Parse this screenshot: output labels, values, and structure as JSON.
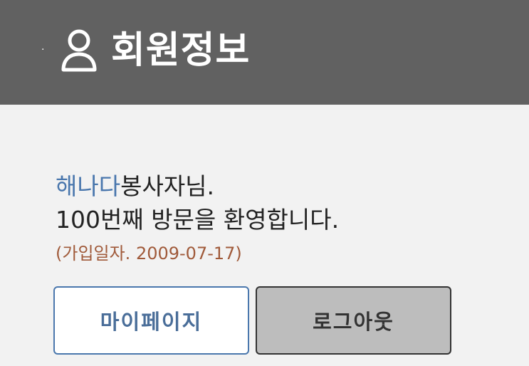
{
  "header": {
    "bullet": "·",
    "icon": "user-icon",
    "title": "회원정보"
  },
  "greeting": {
    "name": "해나다",
    "suffix": "봉사자님."
  },
  "welcome": "100번째 방문을 환영합니다.",
  "join_date": "(가입일자. 2009-07-17)",
  "buttons": {
    "mypage": "마이페이지",
    "logout": "로그아웃"
  },
  "colors": {
    "header_bg": "#616161",
    "accent": "#4a77ad",
    "date_text": "#a05a3a",
    "logout_bg": "#bdbdbd"
  }
}
